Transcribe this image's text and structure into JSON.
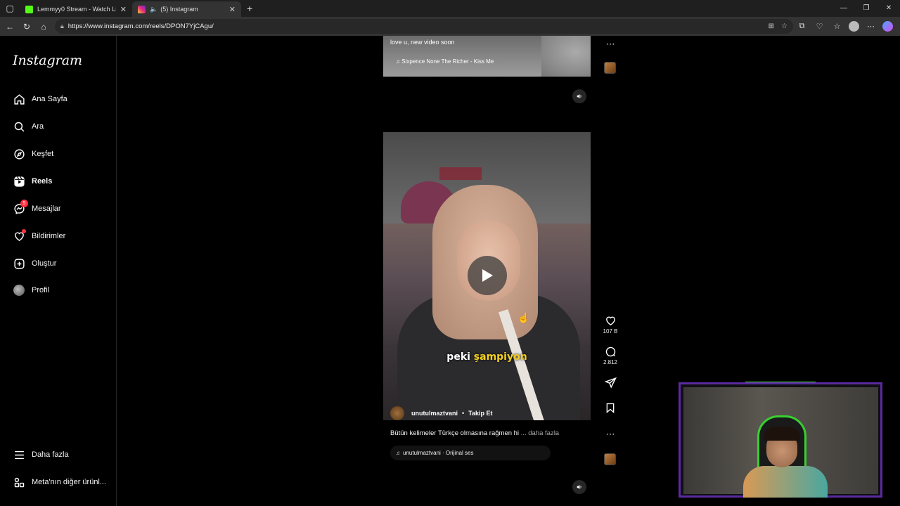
{
  "browser": {
    "tabs": [
      {
        "title": "Lemmyy0 Stream - Watch Live on",
        "favicon_color": "#53fc18",
        "active": false
      },
      {
        "title": "(5) Instagram",
        "favicon_color": "#e1306c",
        "active": true
      }
    ],
    "url": "https://www.instagram.com/reels/DPON7YjCAgu/"
  },
  "sidebar": {
    "logo": "Instagram",
    "items": [
      {
        "label": "Ana Sayfa",
        "icon": "home-icon"
      },
      {
        "label": "Ara",
        "icon": "search-icon"
      },
      {
        "label": "Keşfet",
        "icon": "compass-icon"
      },
      {
        "label": "Reels",
        "icon": "reels-icon"
      },
      {
        "label": "Mesajlar",
        "icon": "messenger-icon",
        "badge": "5"
      },
      {
        "label": "Bildirimler",
        "icon": "heart-icon"
      },
      {
        "label": "Oluştur",
        "icon": "plus-square-icon"
      },
      {
        "label": "Profil",
        "icon": "avatar"
      }
    ],
    "bottom": [
      {
        "label": "Daha fazla",
        "icon": "menu-icon"
      },
      {
        "label": "Meta'nın diğer ürünl...",
        "icon": "meta-apps-icon"
      }
    ]
  },
  "previous_reel": {
    "caption": "love u, new video soon",
    "music": "Sixpence None The Richer - Kiss Me"
  },
  "current_reel": {
    "subtitle_before": "peki ",
    "subtitle_highlight": "şampiyon",
    "author": "unutulmaztvani",
    "separator": "•",
    "follow": "Takip Et",
    "caption": "Bütün kelimeler Türkçe olmasına rağmen hi",
    "caption_more": " ... daha fazla",
    "audio": "unutulmaztvani · Orijinal ses",
    "likes": "107 B",
    "comments": "2.812"
  },
  "colors": {
    "accent": "#ff3040",
    "subtitle_highlight": "#f5d020"
  }
}
